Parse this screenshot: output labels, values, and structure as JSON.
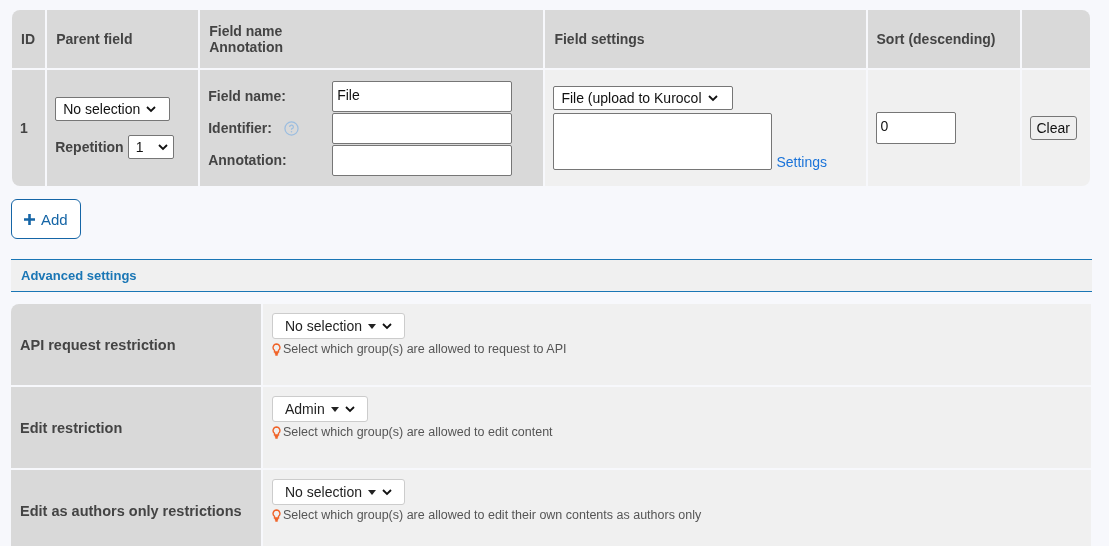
{
  "table": {
    "columns": [
      {
        "lines": [
          "ID"
        ]
      },
      {
        "lines": [
          "Parent field"
        ]
      },
      {
        "lines": [
          "Field name",
          "Annotation"
        ]
      },
      {
        "lines": [
          "Field settings"
        ]
      },
      {
        "lines": [
          "Sort (descending)"
        ]
      }
    ],
    "rows": [
      {
        "id": "1",
        "parent": "No selection",
        "repetition_label": "Repetition",
        "repetition": "1",
        "fields": [
          {
            "label": "Field name:",
            "value": "File",
            "help": false
          },
          {
            "label": "Identifier:",
            "help": true
          },
          {
            "label": "Annotation:",
            "help": false
          }
        ],
        "field_type": "File (upload to Kurocol",
        "settings_link": "Settings",
        "sort": "0",
        "clear": "Clear"
      }
    ]
  },
  "add_button": "Add",
  "advanced": {
    "title": "Advanced settings",
    "rows": [
      {
        "label": "API request restriction",
        "value": "No selection",
        "hint": "Select which group(s) are allowed to request to API"
      },
      {
        "label": "Edit restriction",
        "value": "Admin",
        "hint": "Select which group(s) are allowed to edit content"
      },
      {
        "label": "Edit as authors only restrictions",
        "value": "No selection",
        "hint": "Select which group(s) are allowed to edit their own contents as authors only"
      }
    ]
  }
}
